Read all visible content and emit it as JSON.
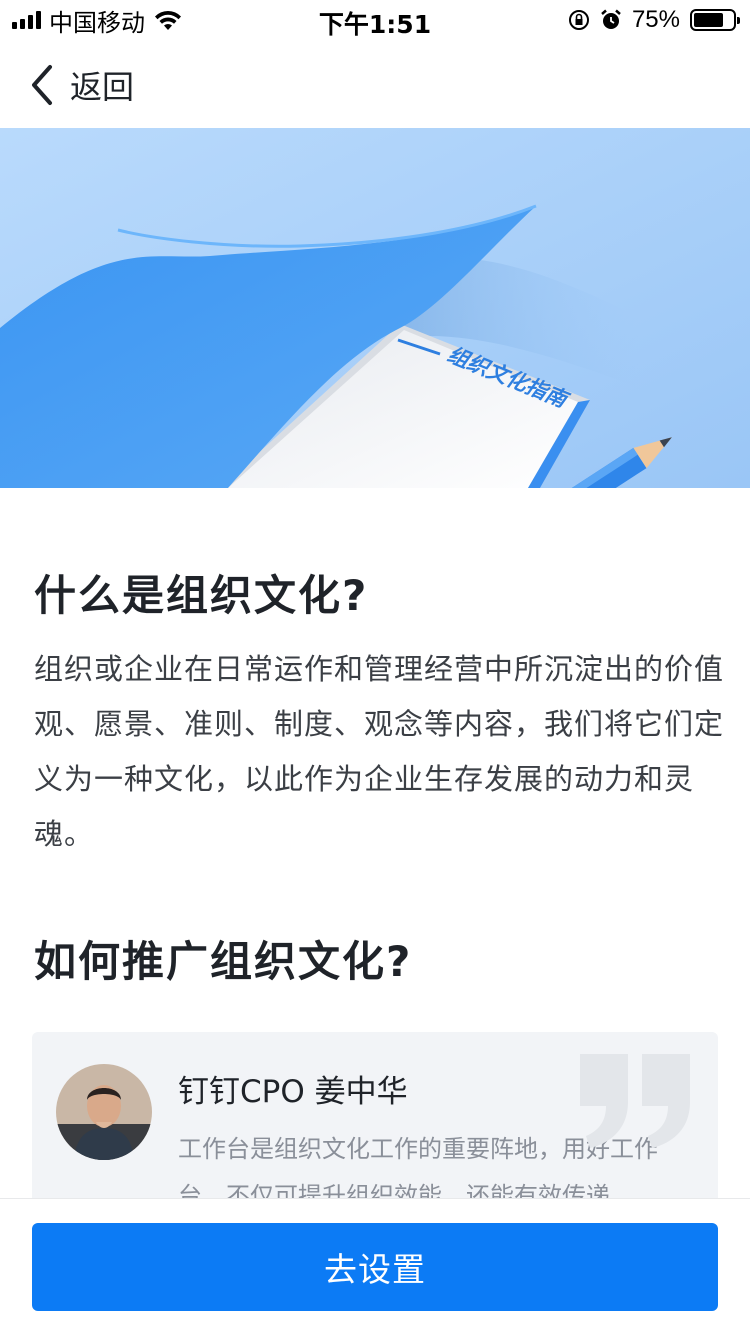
{
  "status_bar": {
    "carrier": "中国移动",
    "time": "下午1:51",
    "battery_percent": "75%",
    "battery_level": 0.75
  },
  "nav": {
    "back_label": "返回"
  },
  "hero": {
    "book_title": "组织文化指南"
  },
  "section1": {
    "title": "什么是组织文化?",
    "body": "组织或企业在日常运作和管理经营中所沉淀出的价值观、愿景、准则、制度、观念等内容，我们将它们定义为一种文化，以此作为企业生存发展的动力和灵魂。"
  },
  "section2": {
    "title": "如何推广组织文化?"
  },
  "quote": {
    "name": "钉钉CPO  姜中华",
    "text": "工作台是组织文化工作的重要阵地，用好工作台，不仅可提升组织效能，还能有效传递"
  },
  "cta": {
    "label": "去设置"
  },
  "colors": {
    "primary": "#0c7bf5",
    "hero_bg": "#a8cff8"
  },
  "icons": [
    "signal-icon",
    "wifi-icon",
    "rotation-lock-icon",
    "alarm-icon",
    "battery-icon",
    "back-chevron-icon",
    "quote-mark-icon"
  ]
}
